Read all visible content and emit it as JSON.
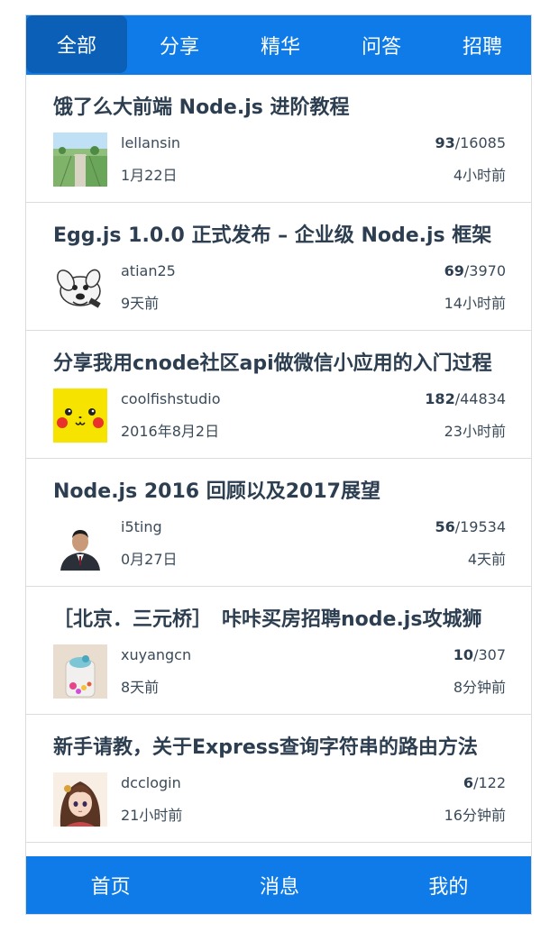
{
  "tabs": [
    {
      "label": "全部",
      "active": true
    },
    {
      "label": "分享",
      "active": false
    },
    {
      "label": "精华",
      "active": false
    },
    {
      "label": "问答",
      "active": false
    },
    {
      "label": "招聘",
      "active": false
    }
  ],
  "topics": [
    {
      "title": "饿了么大前端 Node.js 进阶教程",
      "author": "lellansin",
      "created": "1月22日",
      "reply_count": "93",
      "visit_count": "/16085",
      "last_reply": "4小时前",
      "avatar_icon": "landscape-photo-avatar"
    },
    {
      "title": "Egg.js 1.0.0 正式发布 – 企业级 Node.js 框架",
      "author": "atian25",
      "created": "9天前",
      "reply_count": "69",
      "visit_count": "/3970",
      "last_reply": "14小时前",
      "avatar_icon": "cartoon-dog-avatar"
    },
    {
      "title": "分享我用cnode社区api做微信小应用的入门过程",
      "author": "coolfishstudio",
      "created": "2016年8月2日",
      "reply_count": "182",
      "visit_count": "/44834",
      "last_reply": "23小时前",
      "avatar_icon": "pikachu-avatar"
    },
    {
      "title": "Node.js 2016 回顾以及2017展望",
      "author": "i5ting",
      "created": "0月27日",
      "reply_count": "56",
      "visit_count": "/19534",
      "last_reply": "4天前",
      "avatar_icon": "person-portrait-avatar"
    },
    {
      "title": "［北京．三元桥］　咔咔买房招聘node.js攻城狮",
      "author": "xuyangcn",
      "created": "8天前",
      "reply_count": "10",
      "visit_count": "/307",
      "last_reply": "8分钟前",
      "avatar_icon": "jar-photo-avatar"
    },
    {
      "title": "新手请教，关于Express查询字符串的路由方法",
      "author": "dcclogin",
      "created": "21小时前",
      "reply_count": "6",
      "visit_count": "/122",
      "last_reply": "16分钟前",
      "avatar_icon": "anime-girl-avatar"
    },
    {
      "title": "",
      "author": "",
      "created": "",
      "reply_count": "",
      "visit_count": "",
      "last_reply": "",
      "avatar_icon": ""
    }
  ],
  "bottom_nav": [
    {
      "label": "首页"
    },
    {
      "label": "消息"
    },
    {
      "label": "我的"
    }
  ],
  "colors": {
    "brand_blue": "#0f7be8",
    "active_tab": "#0b5fb6",
    "text": "#2c3e50",
    "divider": "#dcdcdc"
  }
}
